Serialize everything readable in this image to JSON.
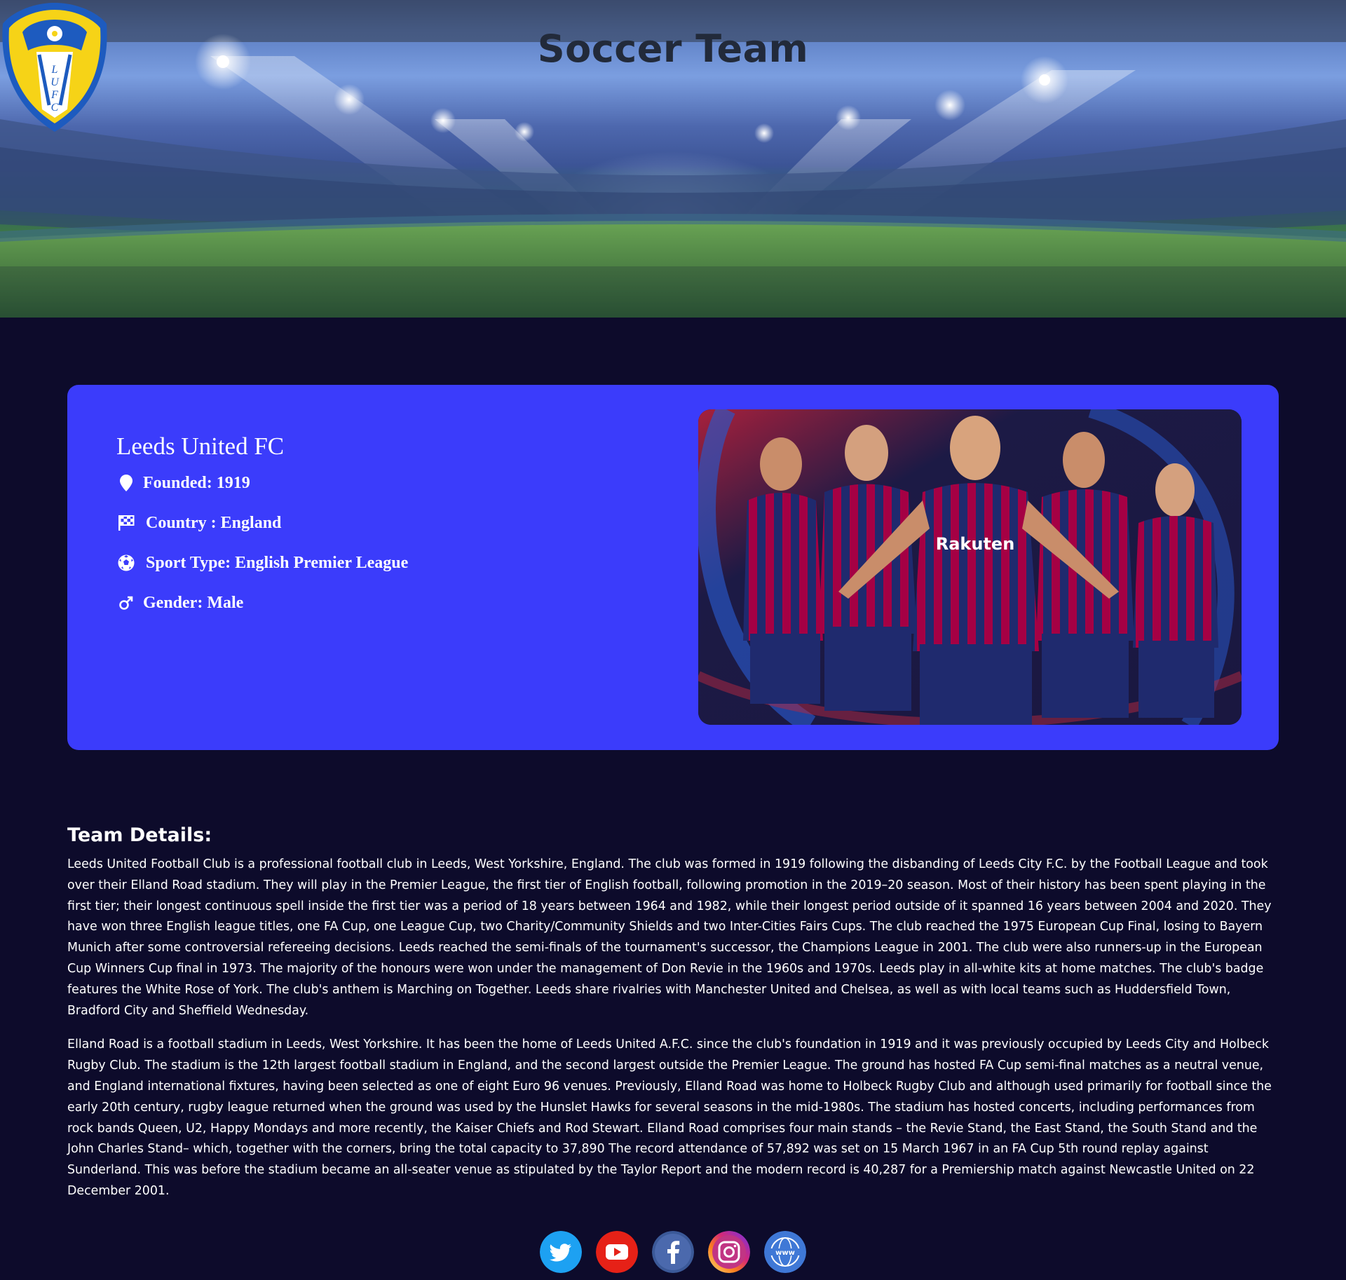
{
  "header": {
    "title": "Soccer Team",
    "crest_text": "LUFC"
  },
  "team": {
    "name": "Leeds United FC",
    "founded": "Founded: 1919",
    "country": "Country : England",
    "sport_type": "Sport Type: English Premier League",
    "gender": "Gender: Male",
    "photo_shirt_text": "Rakuten",
    "icons": [
      "map-pin-icon",
      "checkered-flag-icon",
      "soccer-ball-icon",
      "male-symbol-icon"
    ]
  },
  "details": {
    "heading": "Team Details:",
    "paragraph_1": "Leeds United Football Club is a professional football club in Leeds, West Yorkshire, England. The club was formed in 1919 following the disbanding of Leeds City F.C. by the Football League and took over their Elland Road stadium. They will play in the Premier League, the first tier of English football, following promotion in the 2019–20 season. Most of their history has been spent playing in the first tier; their longest continuous spell inside the first tier was a period of 18 years between 1964 and 1982, while their longest period outside of it spanned 16 years between 2004 and 2020. They have won three English league titles, one FA Cup, one League Cup, two Charity/Community Shields and two Inter-Cities Fairs Cups. The club reached the 1975 European Cup Final, losing to Bayern Munich after some controversial refereeing decisions. Leeds reached the semi-finals of the tournament's successor, the Champions League in 2001. The club were also runners-up in the European Cup Winners Cup final in 1973. The majority of the honours were won under the management of Don Revie in the 1960s and 1970s. Leeds play in all-white kits at home matches. The club's badge features the White Rose of York. The club's anthem is Marching on Together. Leeds share rivalries with Manchester United and Chelsea, as well as with local teams such as Huddersfield Town, Bradford City and Sheffield Wednesday.",
    "paragraph_2": "Elland Road is a football stadium in Leeds, West Yorkshire. It has been the home of Leeds United A.F.C. since the club's foundation in 1919 and it was previously occupied by Leeds City and Holbeck Rugby Club. The stadium is the 12th largest football stadium in England, and the second largest outside the Premier League. The ground has hosted FA Cup semi-final matches as a neutral venue, and England international fixtures, having been selected as one of eight Euro 96 venues. Previously, Elland Road was home to Holbeck Rugby Club and although used primarily for football since the early 20th century, rugby league returned when the ground was used by the Hunslet Hawks for several seasons in the mid-1980s. The stadium has hosted concerts, including performances from rock bands Queen, U2, Happy Mondays and more recently, the Kaiser Chiefs and Rod Stewart. Elland Road comprises four main stands – the Revie Stand, the East Stand, the South Stand and the John Charles Stand– which, together with the corners, bring the total capacity to 37,890 The record attendance of 57,892 was set on 15 March 1967 in an FA Cup 5th round replay against Sunderland. This was before the stadium became an all-seater venue as stipulated by the Taylor Report and the modern record is 40,287 for a Premiership match against Newcastle United on 22 December 2001."
  },
  "social": [
    "twitter-icon",
    "youtube-icon",
    "facebook-icon",
    "instagram-icon",
    "website-icon"
  ],
  "colors": {
    "page_bg": "#0d0b2b",
    "card_bg": "#3b3cfb",
    "crest_yellow": "#f6d317",
    "crest_blue": "#1d5bbf"
  }
}
